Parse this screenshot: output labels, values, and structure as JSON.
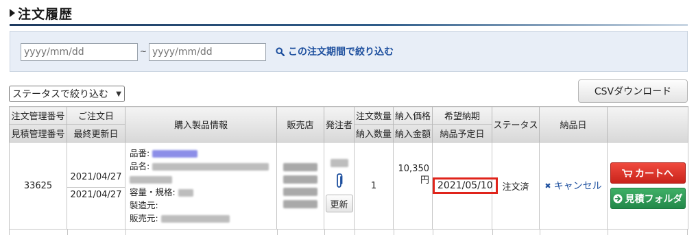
{
  "page": {
    "title": "注文履歴"
  },
  "filter": {
    "date_from_placeholder": "yyyy/mm/dd",
    "date_to_placeholder": "yyyy/mm/dd",
    "separator": "~",
    "apply_link": "この注文期間で絞り込む"
  },
  "status_filter": {
    "selected": "ステータスで絞り込む"
  },
  "csv_button": "CSVダウンロード",
  "table": {
    "headers": {
      "order_mgmt_no": "注文管理番号",
      "quote_mgmt_no": "見積管理番号",
      "order_date": "ご注文日",
      "last_updated": "最終更新日",
      "product_info": "購入製品情報",
      "shop": "販売店",
      "orderer": "発注者",
      "order_qty": "注文数量",
      "delivered_qty": "納入数量",
      "delivery_price": "納入価格",
      "delivery_amount": "納入金額",
      "desired_delivery": "希望納期",
      "planned_delivery": "納品予定日",
      "status": "ステータス",
      "delivery_date": "納品日"
    },
    "rows": [
      {
        "order_no": "33625",
        "order_date": "2021/04/27",
        "updated_date": "2021/04/27",
        "product_labels": {
          "part_no": "品番:",
          "name": "品名:",
          "capacity": "容量・規格:",
          "maker": "製造元:",
          "seller": "販売元:"
        },
        "update_button": "更新",
        "qty": "1",
        "price": "10,350",
        "price_unit": "円",
        "desired_delivery": "2021/05/10",
        "status": "注文済",
        "cancel_link": "キャンセル",
        "cart_button": "カートへ",
        "quote_button": "見積フォルダ"
      }
    ]
  },
  "colors": {
    "title_rule": "#1e3a5f",
    "filter_bg": "#e8eef7",
    "link": "#1d4f9e",
    "cart_button": "#d9322a",
    "quote_button": "#2f9c58",
    "highlight": "#e0241b"
  },
  "icons": {
    "title": "triangle-right-icon",
    "filter": "search-icon",
    "clip": "paperclip-icon",
    "cancel": "x-icon",
    "cart": "cart-icon",
    "quote": "arrow-circle-right-icon"
  }
}
